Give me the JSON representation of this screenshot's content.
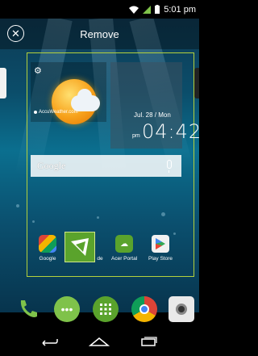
{
  "status_bar": {
    "time": "5:01 pm",
    "icons": [
      "wifi-icon",
      "signal-icon",
      "battery-icon"
    ]
  },
  "top_bar": {
    "action_label": "Remove",
    "close_icon": "close-circle-icon"
  },
  "weather_widget": {
    "provider": "AccuWeather.com",
    "condition_icon": "sun-cloud-icon",
    "settings_icon": "gear-icon"
  },
  "clock_widget": {
    "date": "Jul. 28 / Mon",
    "time": "04:42",
    "ampm": "pm"
  },
  "search_widget": {
    "label": "Google",
    "mic_icon": "mic-icon"
  },
  "home_apps": [
    {
      "label": "Google",
      "icon": "google-folder-icon"
    },
    {
      "label": "de",
      "icon": "acer-guide-icon"
    },
    {
      "label": "Acer Portal",
      "icon": "acer-portal-icon"
    },
    {
      "label": "Play Store",
      "icon": "play-store-icon"
    }
  ],
  "dock": [
    {
      "icon": "phone-icon"
    },
    {
      "icon": "messaging-icon"
    },
    {
      "icon": "app-drawer-icon"
    },
    {
      "icon": "chrome-icon"
    },
    {
      "icon": "camera-icon"
    }
  ],
  "nav_bar": [
    {
      "icon": "back-icon"
    },
    {
      "icon": "home-icon"
    },
    {
      "icon": "recents-icon"
    }
  ],
  "colors": {
    "selection_frame": "#b4d13c",
    "dragged_icon": "#5aa32c"
  }
}
